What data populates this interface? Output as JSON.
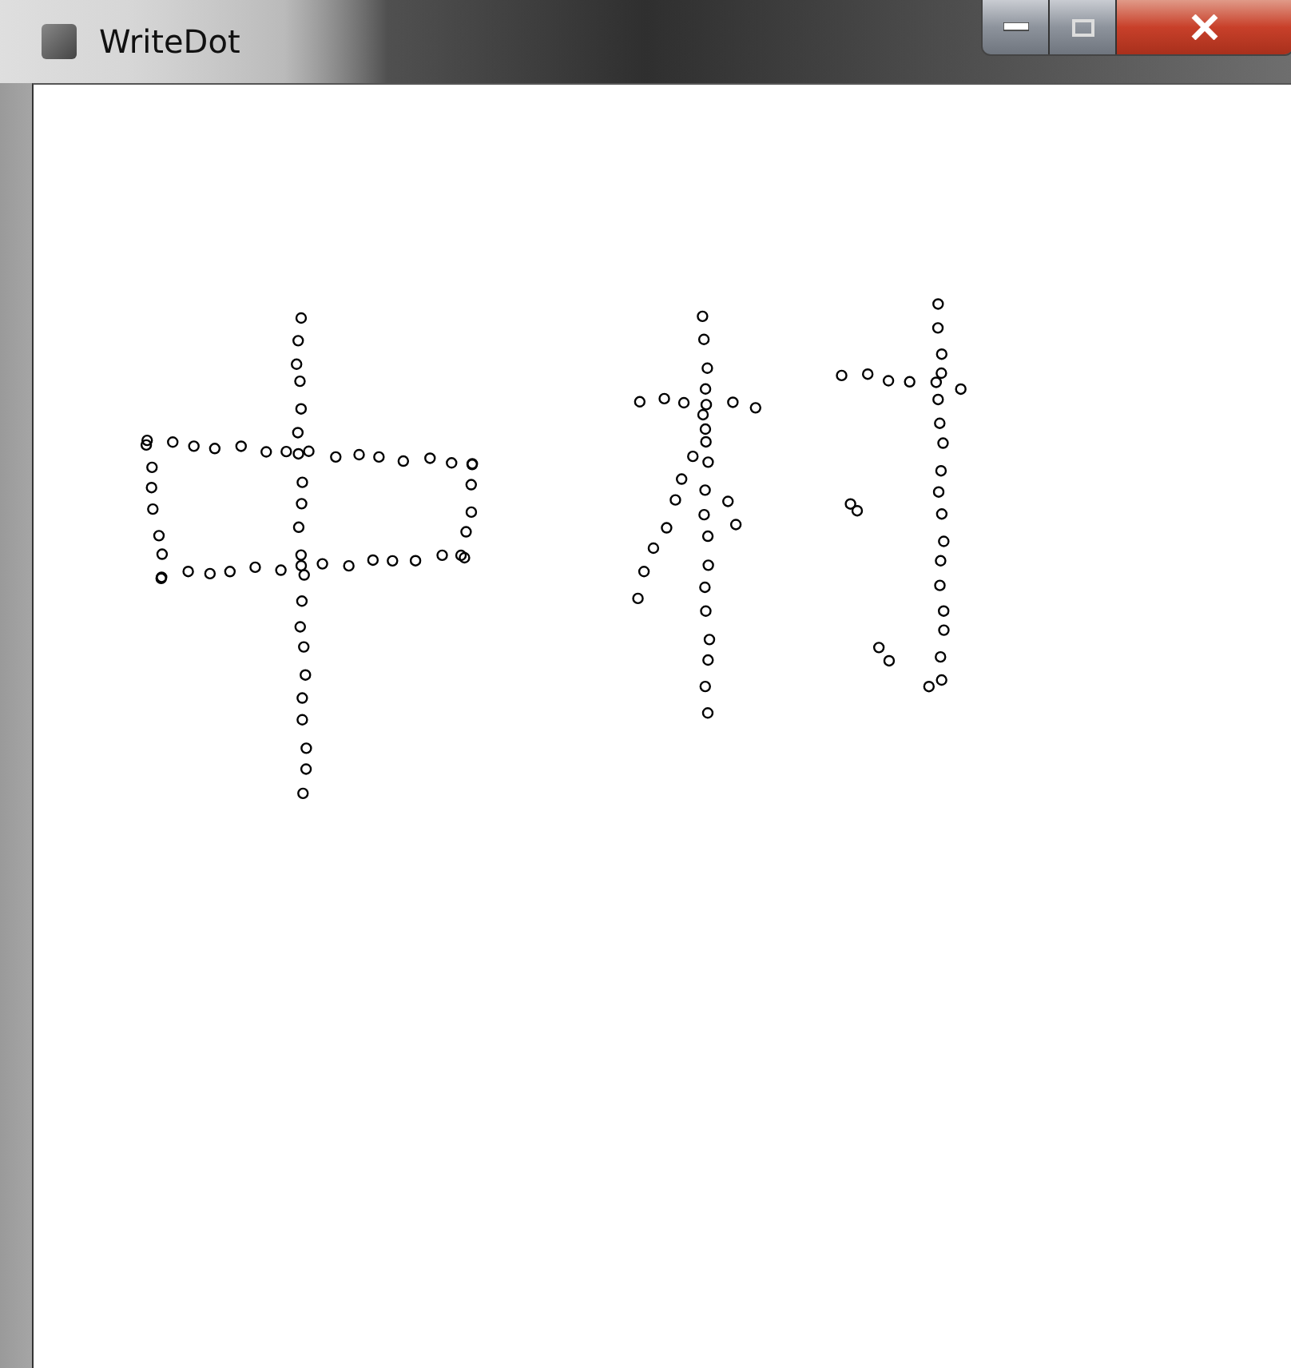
{
  "window": {
    "title": "WriteDot"
  }
}
